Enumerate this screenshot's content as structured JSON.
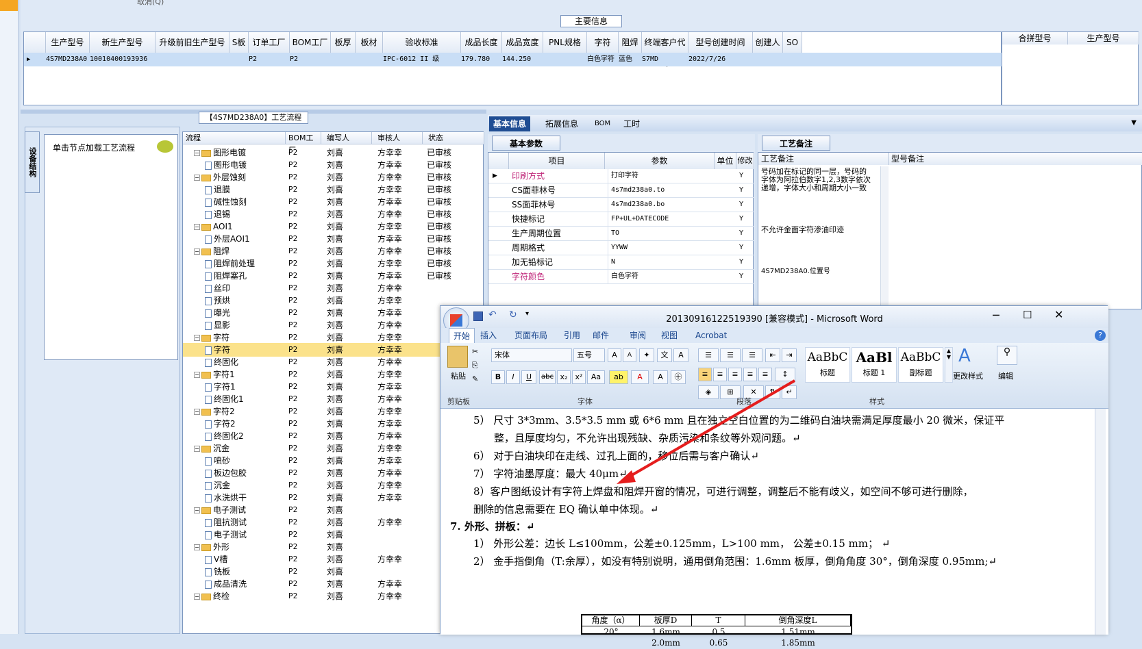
{
  "top_cut_text": "取消(Q)",
  "main_info_title": "主要信息",
  "grid1": {
    "headers": [
      "生产型号",
      "新生产型号",
      "升级前旧生产型号",
      "S板",
      "订单工厂",
      "BOM工厂",
      "板厚",
      "板材",
      "验收标准",
      "成品长度",
      "成品宽度",
      "PNL规格",
      "字符",
      "阻焊",
      "终端客户代码",
      "型号创建时间",
      "创建人",
      "SO"
    ],
    "row": [
      "4S7MD238A0",
      "10010400193936",
      "",
      "",
      "P2",
      "P2",
      "",
      "",
      "IPC-6012 II 级",
      "179.780",
      "144.250",
      "",
      "白色字符",
      "蓝色",
      "S7MD",
      "2022/7/26",
      "",
      ""
    ]
  },
  "merge_headers": [
    "合拼型号",
    "生产型号"
  ],
  "process_title": "【4S7MD238A0】工艺流程",
  "vert_tab": "设备结构",
  "click_label": "单击节点加载工艺流程",
  "tree": {
    "headers": [
      "流程",
      "BOM工厂",
      "编写人",
      "审核人",
      "状态"
    ],
    "rows": [
      {
        "name": "图形电镀",
        "lvl": 0,
        "f": "P2",
        "w": "刘喜",
        "c": "方幸幸",
        "s": "已审核"
      },
      {
        "name": "图形电镀",
        "lvl": 1,
        "f": "P2",
        "w": "刘喜",
        "c": "方幸幸",
        "s": "已审核"
      },
      {
        "name": "外层蚀刻",
        "lvl": 0,
        "f": "P2",
        "w": "刘喜",
        "c": "方幸幸",
        "s": "已审核"
      },
      {
        "name": "退膜",
        "lvl": 1,
        "f": "P2",
        "w": "刘喜",
        "c": "方幸幸",
        "s": "已审核"
      },
      {
        "name": "碱性蚀刻",
        "lvl": 1,
        "f": "P2",
        "w": "刘喜",
        "c": "方幸幸",
        "s": "已审核"
      },
      {
        "name": "退锡",
        "lvl": 1,
        "f": "P2",
        "w": "刘喜",
        "c": "方幸幸",
        "s": "已审核"
      },
      {
        "name": "AOI1",
        "lvl": 0,
        "f": "P2",
        "w": "刘喜",
        "c": "方幸幸",
        "s": "已审核"
      },
      {
        "name": "外层AOI1",
        "lvl": 1,
        "f": "P2",
        "w": "刘喜",
        "c": "方幸幸",
        "s": "已审核"
      },
      {
        "name": "阻焊",
        "lvl": 0,
        "f": "P2",
        "w": "刘喜",
        "c": "方幸幸",
        "s": "已审核"
      },
      {
        "name": "阻焊前处理",
        "lvl": 1,
        "f": "P2",
        "w": "刘喜",
        "c": "方幸幸",
        "s": "已审核"
      },
      {
        "name": "阻焊塞孔",
        "lvl": 1,
        "f": "P2",
        "w": "刘喜",
        "c": "方幸幸",
        "s": "已审核"
      },
      {
        "name": "丝印",
        "lvl": 1,
        "f": "P2",
        "w": "刘喜",
        "c": "方幸幸",
        "s": ""
      },
      {
        "name": "预烘",
        "lvl": 1,
        "f": "P2",
        "w": "刘喜",
        "c": "方幸幸",
        "s": ""
      },
      {
        "name": "曝光",
        "lvl": 1,
        "f": "P2",
        "w": "刘喜",
        "c": "方幸幸",
        "s": ""
      },
      {
        "name": "显影",
        "lvl": 1,
        "f": "P2",
        "w": "刘喜",
        "c": "方幸幸",
        "s": ""
      },
      {
        "name": "字符",
        "lvl": 0,
        "f": "P2",
        "w": "刘喜",
        "c": "方幸幸",
        "s": ""
      },
      {
        "name": "字符",
        "lvl": 1,
        "f": "P2",
        "w": "刘喜",
        "c": "方幸幸",
        "s": "",
        "sel": true
      },
      {
        "name": "终固化",
        "lvl": 1,
        "f": "P2",
        "w": "刘喜",
        "c": "方幸幸",
        "s": ""
      },
      {
        "name": "字符1",
        "lvl": 0,
        "f": "P2",
        "w": "刘喜",
        "c": "方幸幸",
        "s": ""
      },
      {
        "name": "字符1",
        "lvl": 1,
        "f": "P2",
        "w": "刘喜",
        "c": "方幸幸",
        "s": ""
      },
      {
        "name": "终固化1",
        "lvl": 1,
        "f": "P2",
        "w": "刘喜",
        "c": "方幸幸",
        "s": ""
      },
      {
        "name": "字符2",
        "lvl": 0,
        "f": "P2",
        "w": "刘喜",
        "c": "方幸幸",
        "s": ""
      },
      {
        "name": "字符2",
        "lvl": 1,
        "f": "P2",
        "w": "刘喜",
        "c": "方幸幸",
        "s": ""
      },
      {
        "name": "终固化2",
        "lvl": 1,
        "f": "P2",
        "w": "刘喜",
        "c": "方幸幸",
        "s": ""
      },
      {
        "name": "沉金",
        "lvl": 0,
        "f": "P2",
        "w": "刘喜",
        "c": "方幸幸",
        "s": ""
      },
      {
        "name": "喷砂",
        "lvl": 1,
        "f": "P2",
        "w": "刘喜",
        "c": "方幸幸",
        "s": ""
      },
      {
        "name": "板边包胶",
        "lvl": 1,
        "f": "P2",
        "w": "刘喜",
        "c": "方幸幸",
        "s": ""
      },
      {
        "name": "沉金",
        "lvl": 1,
        "f": "P2",
        "w": "刘喜",
        "c": "方幸幸",
        "s": ""
      },
      {
        "name": "水洗烘干",
        "lvl": 1,
        "f": "P2",
        "w": "刘喜",
        "c": "方幸幸",
        "s": ""
      },
      {
        "name": "电子测试",
        "lvl": 0,
        "f": "P2",
        "w": "刘喜",
        "c": "",
        "s": ""
      },
      {
        "name": "阻抗测试",
        "lvl": 1,
        "f": "P2",
        "w": "刘喜",
        "c": "方幸幸",
        "s": ""
      },
      {
        "name": "电子测试",
        "lvl": 1,
        "f": "P2",
        "w": "刘喜",
        "c": "",
        "s": ""
      },
      {
        "name": "外形",
        "lvl": 0,
        "f": "P2",
        "w": "刘喜",
        "c": "",
        "s": ""
      },
      {
        "name": "V槽",
        "lvl": 1,
        "f": "P2",
        "w": "刘喜",
        "c": "方幸幸",
        "s": ""
      },
      {
        "name": "铣板",
        "lvl": 1,
        "f": "P2",
        "w": "刘喜",
        "c": "",
        "s": ""
      },
      {
        "name": "成品清洗",
        "lvl": 1,
        "f": "P2",
        "w": "刘喜",
        "c": "方幸幸",
        "s": ""
      },
      {
        "name": "终检",
        "lvl": 0,
        "f": "P2",
        "w": "刘喜",
        "c": "方幸幸",
        "s": ""
      }
    ]
  },
  "right_tabs": [
    "基本信息",
    "拓展信息",
    "BOM",
    "工时"
  ],
  "basic_group": "基本参数",
  "param_headers": [
    "项目",
    "参数",
    "单位",
    "修改"
  ],
  "params": [
    {
      "k": "印刷方式",
      "v": "打印字符",
      "m": "Y",
      "red": true
    },
    {
      "k": "CS面菲林号",
      "v": "4s7md238a0.to",
      "m": "Y"
    },
    {
      "k": "SS面菲林号",
      "v": "4s7md238a0.bo",
      "m": "Y"
    },
    {
      "k": "快捷标记",
      "v": "FP+UL+DATECODE",
      "m": "Y"
    },
    {
      "k": "生产周期位置",
      "v": "TO",
      "m": "Y"
    },
    {
      "k": "周期格式",
      "v": "YYWW",
      "m": "Y"
    },
    {
      "k": "加无铅标记",
      "v": "N",
      "m": "Y"
    },
    {
      "k": "字符颜色",
      "v": "白色字符",
      "m": "Y",
      "red": true
    }
  ],
  "craft_group": "工艺备注",
  "craft_headers": [
    "工艺备注",
    "型号备注"
  ],
  "craft_notes": [
    "号码加在标记的同一层，号码的字体为阿拉伯数字1,2,3数字依次递增，字体大小和周期大小一致",
    "不允许金面字符渗油印迹",
    "4S7MD238A0.位置号"
  ],
  "word": {
    "title": "20130916122519390 [兼容模式] - Microsoft Word",
    "tabs": [
      "开始",
      "插入",
      "页面布局",
      "引用",
      "邮件",
      "审阅",
      "视图",
      "Acrobat"
    ],
    "font": "宋体",
    "size": "五号",
    "groups": [
      "剪贴板",
      "字体",
      "段落",
      "样式",
      "编辑"
    ],
    "paste": "粘贴",
    "styles": [
      {
        "p": "AaBbC",
        "l": "标题"
      },
      {
        "p": "AaBl",
        "l": "标题 1"
      },
      {
        "p": "AaBbC",
        "l": "副标题"
      }
    ],
    "change_style": "更改样式",
    "edit": "编辑",
    "lines": [
      "5） 尺寸 3*3mm、3.5*3.5 mm 或 6*6 mm 且在独立空白位置的为二维码白油块需满足厚度最小 20 微米，保证平",
      "整，且厚度均匀，不允许出现残缺、杂质污染和条纹等外观问题。↵",
      "6） 对于白油块印在走线、过孔上面的，移位后需与客户确认↵",
      "7） 字符油墨厚度：最大 40μm↵",
      "8）客户图纸设计有字符上焊盘和阻焊开窗的情况，可进行调整，调整后不能有歧义，如空间不够可进行删除，",
      "删除的信息需要在 EQ 确认单中体现。↵",
      "7.  外形、拼板：↵",
      "1） 外形公差：边长 L≤100mm，公差±0.125mm，L>100  mm， 公差±0.15  mm；  ↵",
      "2） 金手指倒角（T:余厚），如没有特别说明，通用倒角范围：1.6mm 板厚，倒角角度 30°，倒角深度 0.95mm;↵"
    ],
    "table_headers": [
      "角度（α）",
      "板厚D",
      "T",
      "倒角深度L"
    ],
    "table_rows": [
      [
        "20°",
        "1.6mm",
        "0.5",
        "1.51mm"
      ],
      [
        "",
        "2.0mm",
        "0.65",
        "1.85mm"
      ]
    ]
  }
}
